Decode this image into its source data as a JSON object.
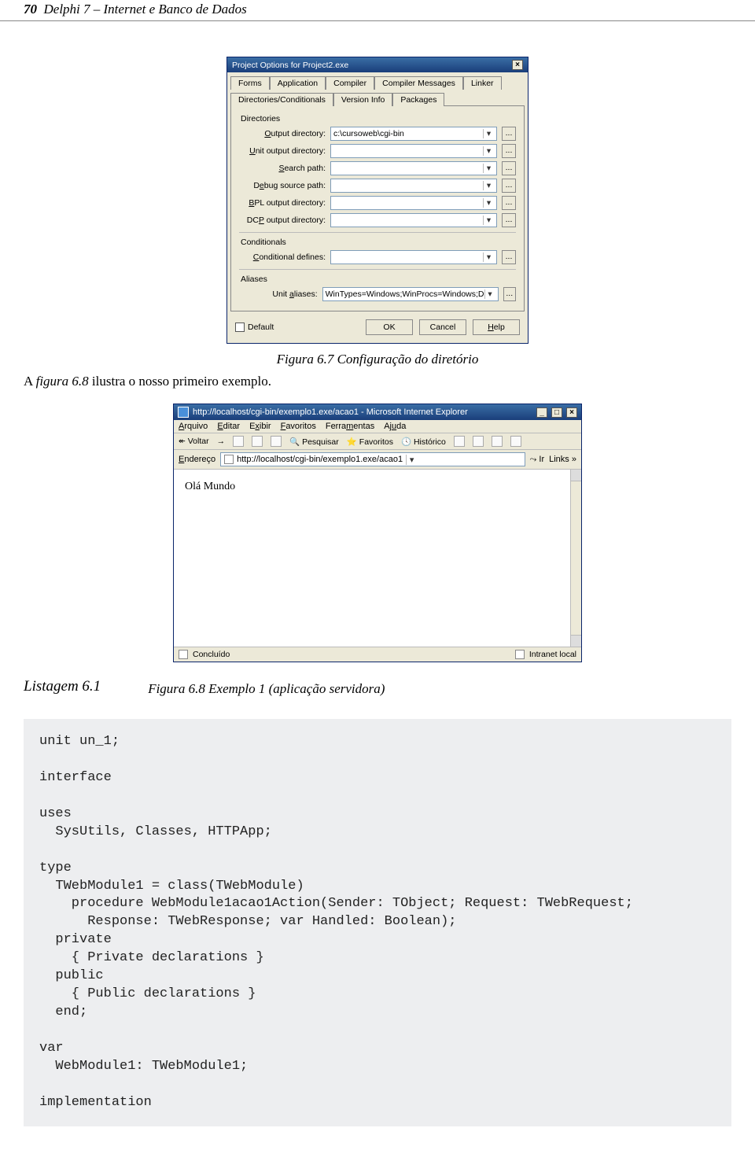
{
  "header": {
    "page_number": "70",
    "book_title": "Delphi 7 – Internet e Banco de Dados"
  },
  "dialog": {
    "title": "Project Options for Project2.exe",
    "tabs_row1": [
      "Forms",
      "Application",
      "Compiler",
      "Compiler Messages",
      "Linker"
    ],
    "tabs_row2": [
      "Directories/Conditionals",
      "Version Info",
      "Packages"
    ],
    "group_directories": "Directories",
    "fields": {
      "output": {
        "label": "Output directory:",
        "value": "c:\\cursoweb\\cgi-bin"
      },
      "unit_output": {
        "label": "Unit output directory:",
        "value": ""
      },
      "search": {
        "label": "Search path:",
        "value": ""
      },
      "debug_source": {
        "label": "Debug source path:",
        "value": ""
      },
      "bpl": {
        "label": "BPL output directory:",
        "value": ""
      },
      "dcp": {
        "label": "DCP output directory:",
        "value": ""
      }
    },
    "group_conditionals": "Conditionals",
    "cond_defines": {
      "label": "Conditional defines:",
      "value": ""
    },
    "group_aliases": "Aliases",
    "unit_aliases": {
      "label": "Unit aliases:",
      "value": "WinTypes=Windows;WinProcs=Windows;D"
    },
    "default_label": "Default",
    "buttons": {
      "ok": "OK",
      "cancel": "Cancel",
      "help": "Help"
    }
  },
  "caption67": "Figura 6.7 Configuração do diretório",
  "body_text_pre": "A ",
  "body_text_ref": "figura 6.8",
  "body_text_post": " ilustra o nosso primeiro exemplo.",
  "ie": {
    "title": "http://localhost/cgi-bin/exemplo1.exe/acao1 - Microsoft Internet Explorer",
    "menu": [
      "Arquivo",
      "Editar",
      "Exibir",
      "Favoritos",
      "Ferramentas",
      "Ajuda"
    ],
    "toolbar": {
      "voltar": "Voltar",
      "pesquisar": "Pesquisar",
      "favoritos": "Favoritos",
      "historico": "Histórico"
    },
    "addr_label": "Endereço",
    "addr_value": "http://localhost/cgi-bin/exemplo1.exe/acao1",
    "ir_label": "Ir",
    "links_label": "Links",
    "body_text": "Olá Mundo",
    "status_left": "Concluído",
    "status_right": "Intranet local"
  },
  "listing_label": "Listagem 6.1",
  "caption68": "Figura 6.8 Exemplo 1 (aplicação servidora)",
  "code": "unit un_1;\n\ninterface\n\nuses\n  SysUtils, Classes, HTTPApp;\n\ntype\n  TWebModule1 = class(TWebModule)\n    procedure WebModule1acao1Action(Sender: TObject; Request: TWebRequest;\n      Response: TWebResponse; var Handled: Boolean);\n  private\n    { Private declarations }\n  public\n    { Public declarations }\n  end;\n\nvar\n  WebModule1: TWebModule1;\n\nimplementation"
}
